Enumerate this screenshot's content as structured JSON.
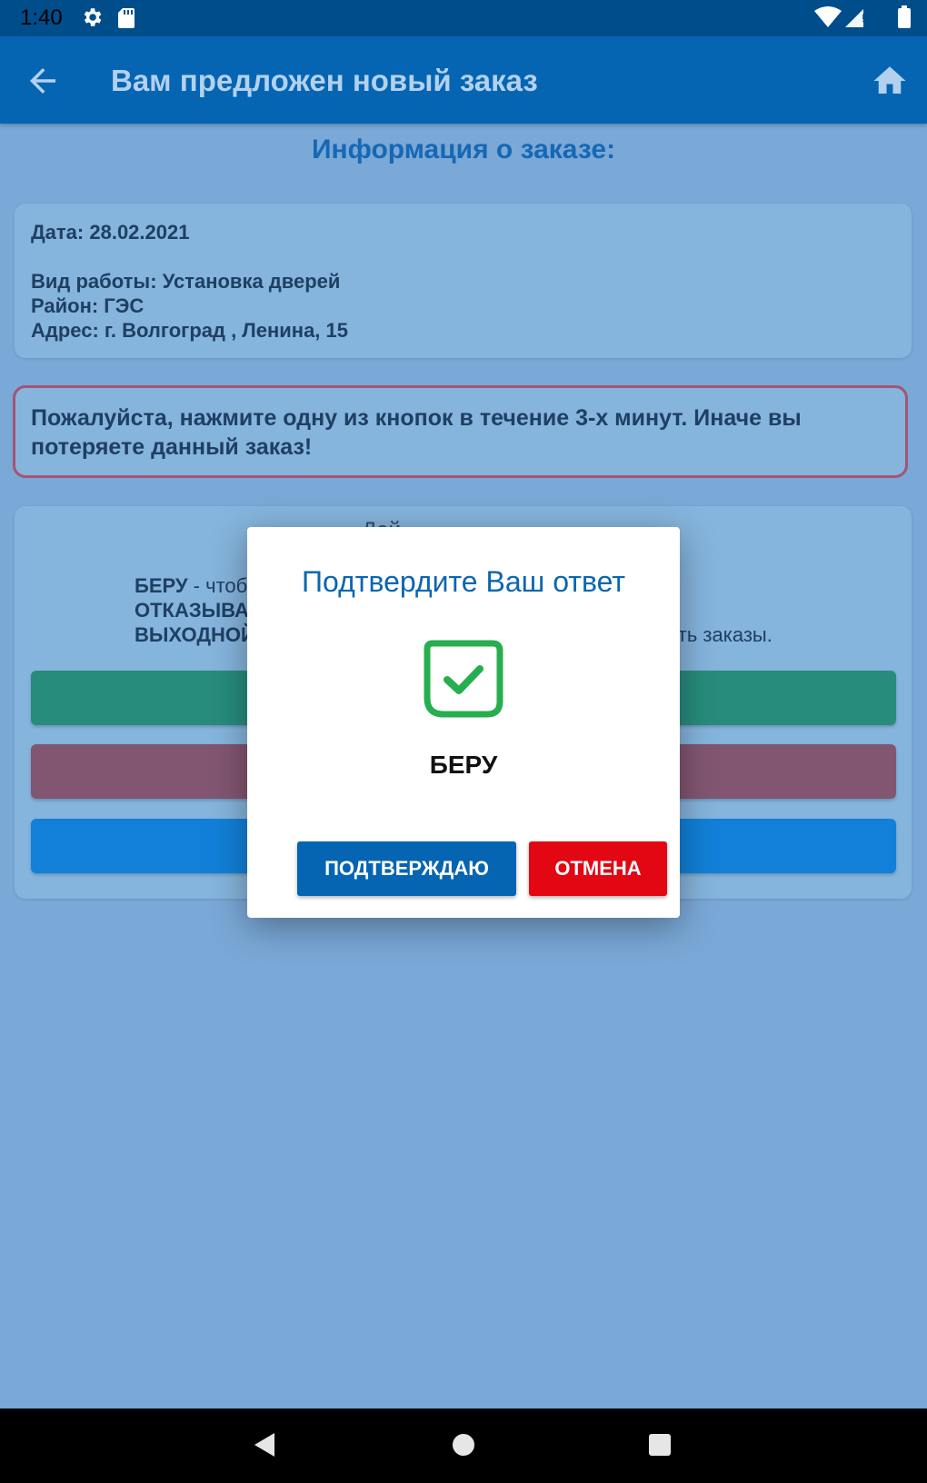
{
  "status_bar": {
    "time": "1:40"
  },
  "app_bar": {
    "title": "Вам предложен новый заказ"
  },
  "section_title": "Информация о заказе:",
  "order": {
    "date_line": "Дата: 28.02.2021",
    "work_type_line": "Вид работы: Установка дверей",
    "district_line": "Район: ГЭС",
    "address_line": "Адрес: г. Волгоград , Ленина, 15"
  },
  "warning": "Пожалуйста, нажмите одну из кнопок в течение 3-х минут. Иначе вы потеряете данный заказ!",
  "background_card": {
    "title_fragment": "Дей",
    "legend_take_label": "БЕРУ",
    "legend_take_fragment": " - чтоб",
    "legend_refuse_fragment": "ОТКАЗЫВА",
    "legend_dayoff_fragment": "ВЫХОДНОЙ",
    "legend_right_fragment": "ать заказы."
  },
  "dialog": {
    "title": "Подтвердите Ваш ответ",
    "answer": "БЕРУ",
    "confirm_label": "ПОДТВЕРЖДАЮ",
    "cancel_label": "ОТМЕНА",
    "icon": "check-square-icon"
  },
  "colors": {
    "app_bar": "#0565b3",
    "take_button": "#278c7c",
    "refuse_button": "#825671",
    "dayoff_button": "#1280d8",
    "confirm_button": "#0565b3",
    "cancel_button": "#e30613",
    "check_icon": "#27ae4f"
  }
}
